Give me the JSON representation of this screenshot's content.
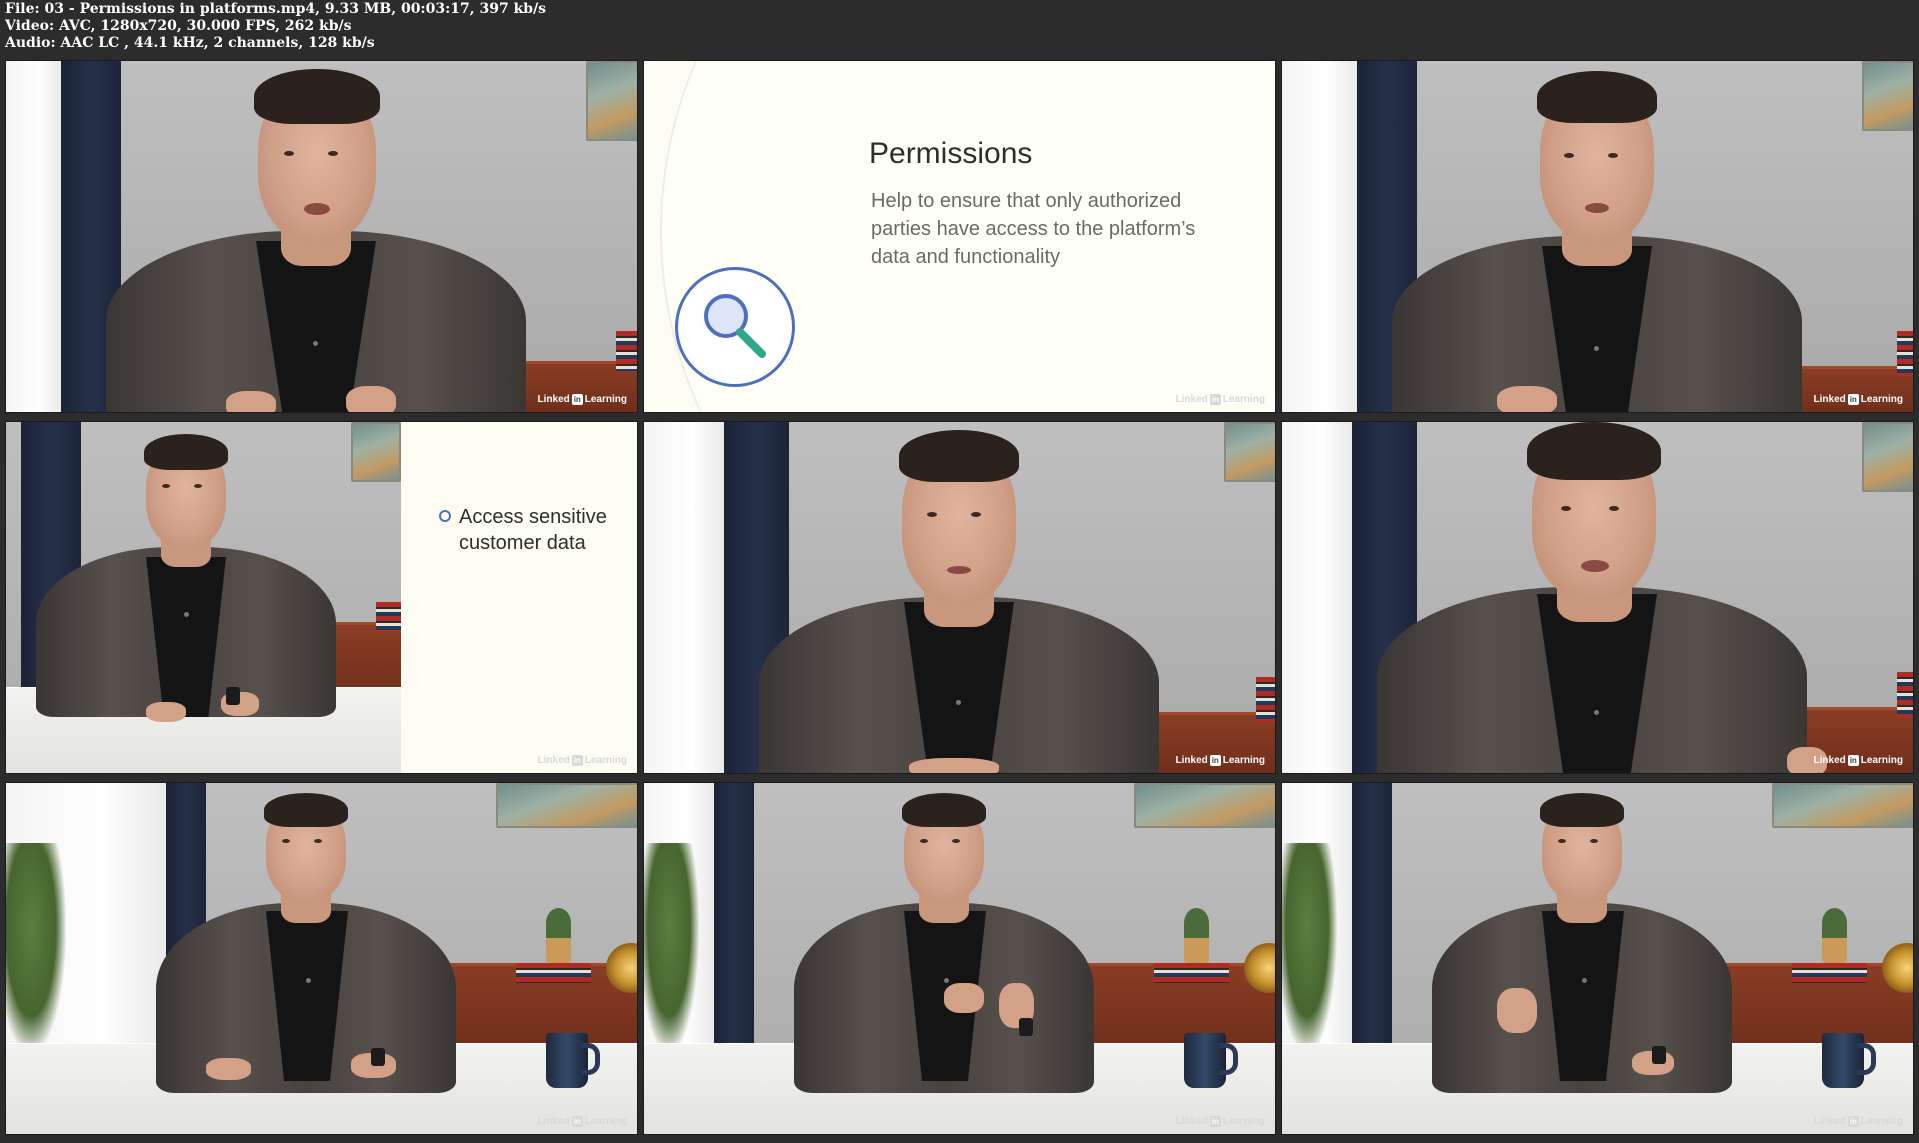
{
  "file_info": {
    "line1": "File: 03 - Permissions in platforms.mp4, 9.33 MB, 00:03:17, 397 kb/s",
    "line2": "Video: AVC, 1280x720, 30.000 FPS, 262 kb/s",
    "line3": "Audio: AAC LC , 44.1 kHz, 2 channels, 128 kb/s"
  },
  "branding": {
    "logo_word1": "Linked",
    "logo_in": "in",
    "logo_word2": "Learning"
  },
  "slide1": {
    "title": "Permissions",
    "body": "Help to ensure that only authorized parties have access to the platform’s data and functionality",
    "icon": "magnifying-glass-icon",
    "accent": "#4d6fbf",
    "handle_color": "#2fa88a"
  },
  "slide2": {
    "bullet": "Access sensitive customer data"
  },
  "colors": {
    "background": "#2c2c2c",
    "slide_bg": "#fdfcf3"
  }
}
